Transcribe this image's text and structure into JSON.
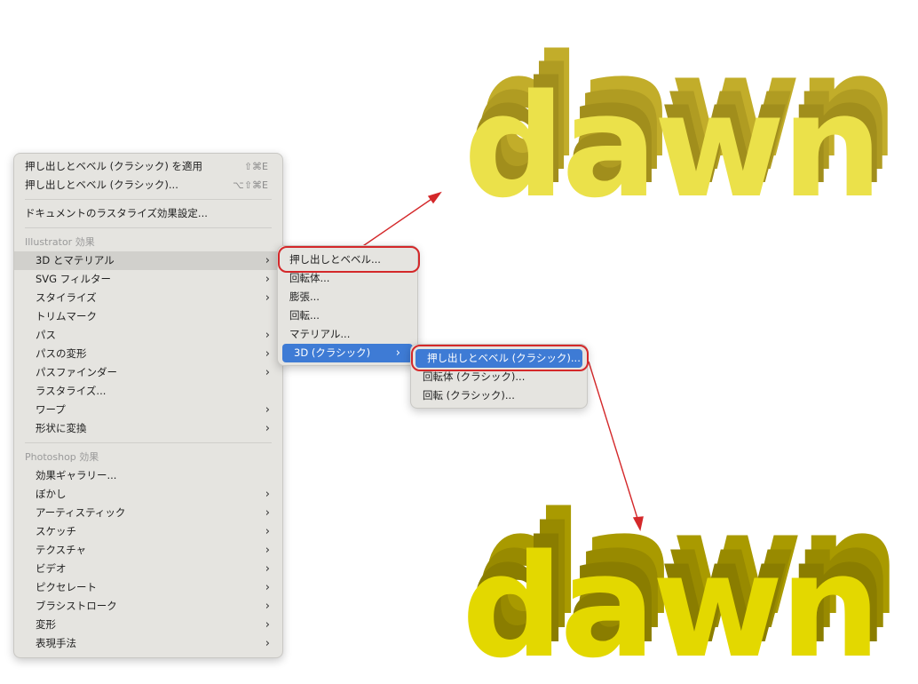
{
  "main_menu": {
    "top_items": [
      {
        "label": "押し出しとベベル (クラシック) を適用",
        "shortcut": "⇧⌘E"
      },
      {
        "label": "押し出しとベベル (クラシック)...",
        "shortcut": "⌥⇧⌘E"
      }
    ],
    "rasterize_settings": "ドキュメントのラスタライズ効果設定...",
    "illustrator_header": "Illustrator 効果",
    "illustrator_items": [
      {
        "label": "3D とマテリアル",
        "submenu": true
      },
      {
        "label": "SVG フィルター",
        "submenu": true
      },
      {
        "label": "スタイライズ",
        "submenu": true
      },
      {
        "label": "トリムマーク",
        "submenu": false
      },
      {
        "label": "パス",
        "submenu": true
      },
      {
        "label": "パスの変形",
        "submenu": true
      },
      {
        "label": "パスファインダー",
        "submenu": true
      },
      {
        "label": "ラスタライズ...",
        "submenu": false
      },
      {
        "label": "ワープ",
        "submenu": true
      },
      {
        "label": "形状に変換",
        "submenu": true
      }
    ],
    "photoshop_header": "Photoshop 効果",
    "photoshop_items": [
      {
        "label": "効果ギャラリー...",
        "submenu": false
      },
      {
        "label": "ぼかし",
        "submenu": true
      },
      {
        "label": "アーティスティック",
        "submenu": true
      },
      {
        "label": "スケッチ",
        "submenu": true
      },
      {
        "label": "テクスチャ",
        "submenu": true
      },
      {
        "label": "ビデオ",
        "submenu": true
      },
      {
        "label": "ピクセレート",
        "submenu": true
      },
      {
        "label": "ブラシストローク",
        "submenu": true
      },
      {
        "label": "変形",
        "submenu": true
      },
      {
        "label": "表現手法",
        "submenu": true
      }
    ]
  },
  "submenu_3d": {
    "items": [
      {
        "label": "押し出しとベベル..."
      },
      {
        "label": "回転体..."
      },
      {
        "label": "膨張..."
      },
      {
        "label": "回転..."
      },
      {
        "label": "マテリアル..."
      },
      {
        "label": "3D (クラシック)",
        "submenu": true
      }
    ]
  },
  "submenu_classic": {
    "items": [
      {
        "label": "押し出しとベベル (クラシック)..."
      },
      {
        "label": "回転体 (クラシック)..."
      },
      {
        "label": "回転 (クラシック)..."
      }
    ]
  },
  "artwork": {
    "top_word": "dawn",
    "bottom_word": "dawn"
  },
  "colors": {
    "highlight_ring": "#d4282a",
    "selection": "#3e7bd5",
    "top_3d_face": "#ebe14a",
    "top_3d_side": "#b8a524",
    "bottom_3d_face": "#e3d800",
    "bottom_3d_side": "#a99a00"
  }
}
